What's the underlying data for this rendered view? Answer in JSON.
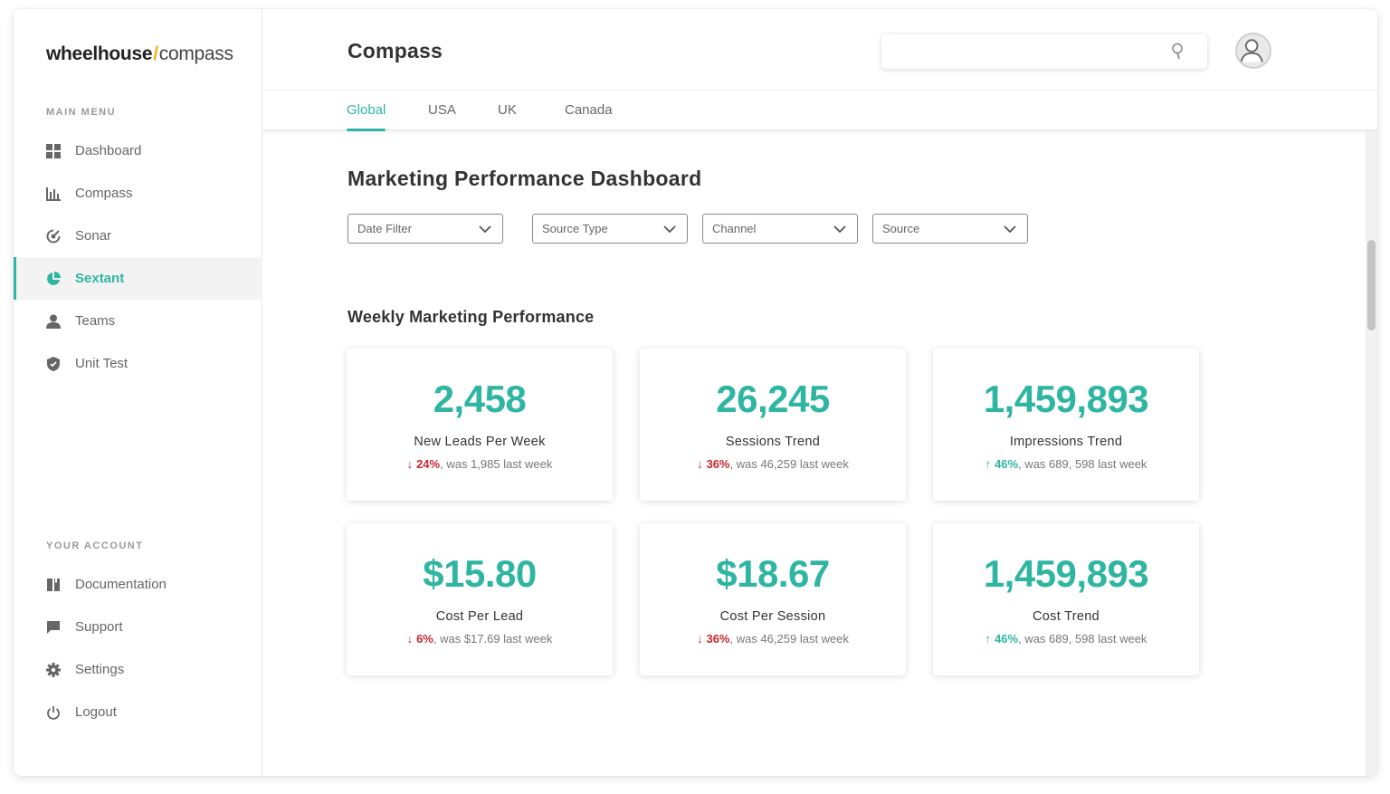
{
  "sidebar": {
    "logo": {
      "part1": "wheelhouse",
      "slash": "/",
      "part2": "compass"
    },
    "main_menu_label": "MAIN MENU",
    "main_items": [
      {
        "label": "Dashboard",
        "icon": "dashboard-icon",
        "active": false
      },
      {
        "label": "Compass",
        "icon": "bar-chart-icon",
        "active": false
      },
      {
        "label": "Sonar",
        "icon": "sonar-icon",
        "active": false
      },
      {
        "label": "Sextant",
        "icon": "pie-chart-icon",
        "active": true
      },
      {
        "label": "Teams",
        "icon": "user-icon",
        "active": false
      },
      {
        "label": "Unit Test",
        "icon": "shield-icon",
        "active": false
      }
    ],
    "account_label": "YOUR ACCOUNT",
    "account_items": [
      {
        "label": "Documentation",
        "icon": "book-icon"
      },
      {
        "label": "Support",
        "icon": "chat-icon"
      },
      {
        "label": "Settings",
        "icon": "gear-icon"
      },
      {
        "label": "Logout",
        "icon": "power-icon"
      }
    ]
  },
  "header": {
    "title": "Compass",
    "search": {
      "value": "",
      "placeholder": ""
    }
  },
  "tabs": [
    {
      "label": "Global",
      "active": true
    },
    {
      "label": "USA",
      "active": false
    },
    {
      "label": "UK",
      "active": false
    },
    {
      "label": "Canada",
      "active": false
    }
  ],
  "main": {
    "title": "Marketing Performance Dashboard",
    "filters": [
      "Date Filter",
      "Source Type",
      "Channel",
      "Source"
    ],
    "section_title": "Weekly Marketing Performance",
    "cards": [
      {
        "value": "2,458",
        "label": "New Leads Per Week",
        "direction": "down",
        "arrow": "↓",
        "pct": "24%",
        "rest": ", was 1,985 last week"
      },
      {
        "value": "26,245",
        "label": "Sessions Trend",
        "direction": "down",
        "arrow": "↓",
        "pct": "36%",
        "rest": ", was 46,259  last week"
      },
      {
        "value": "1,459,893",
        "label": "Impressions Trend",
        "direction": "up",
        "arrow": "↑",
        "pct": "46%",
        "rest": ", was 689, 598  last week"
      },
      {
        "value": "$15.80",
        "label": "Cost Per Lead",
        "direction": "down",
        "arrow": "↓",
        "pct": "6%",
        "rest": ", was $17.69 last week"
      },
      {
        "value": "$18.67",
        "label": "Cost Per Session",
        "direction": "down",
        "arrow": "↓",
        "pct": "36%",
        "rest": ", was 46,259  last week"
      },
      {
        "value": "1,459,893",
        "label": "Cost Trend",
        "direction": "up",
        "arrow": "↑",
        "pct": "46%",
        "rest": ", was 689, 598  last week"
      }
    ]
  },
  "colors": {
    "accent": "#2fb6a2",
    "down": "#c8262f",
    "logo_slash": "#f2b01e"
  }
}
